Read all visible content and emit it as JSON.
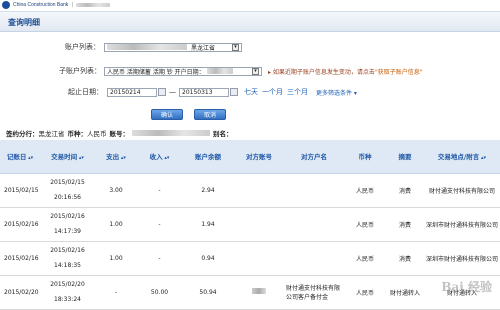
{
  "header": {
    "bank_name_en": "China Construction Bank",
    "page_title": "查询明细"
  },
  "form": {
    "account_list_label": "账户列表：",
    "account_list_value": "黑龙江省",
    "sub_account_label": "子账户列表：",
    "sub_account_value": "人民币 活期储蓄 活期 钞 开户日期：",
    "sub_account_hint": "如果近期子账户信息发生变动，请点击",
    "sub_account_hint_link": "\"获取子账户信息\"",
    "date_label": "起止日期：",
    "date_from": "20150214",
    "date_sep": "—",
    "date_to": "20150313",
    "quick_7d": "七天",
    "quick_1m": "一个月",
    "quick_3m": "三个月",
    "more_filters": "更多筛选条件 ▾",
    "confirm_label": "确认",
    "cancel_label": "取消"
  },
  "info": {
    "branch_label": "签约分行：",
    "branch_value": "黑龙江省",
    "currency_label": "币种：",
    "currency_value": "人民币",
    "account_label": "账号：",
    "alias_label": "别名："
  },
  "table": {
    "headers": [
      "记账日",
      "交易时间",
      "支出",
      "收入",
      "账户余额",
      "对方账号",
      "对方户名",
      "币种",
      "摘要",
      "交易地点/附言"
    ],
    "rows": [
      {
        "date": "2015/02/15",
        "time_date": "2015/02/15",
        "time_clock": "20:16:56",
        "out": "3.00",
        "in": "-",
        "balance": "2.94",
        "cp_account": "",
        "cp_name": "",
        "currency": "人民币",
        "summary": "消费",
        "place": "财付通支付科技有限公司"
      },
      {
        "date": "2015/02/16",
        "time_date": "2015/02/16",
        "time_clock": "14:17:39",
        "out": "1.00",
        "in": "-",
        "balance": "1.94",
        "cp_account": "",
        "cp_name": "",
        "currency": "人民币",
        "summary": "消费",
        "place": "深圳市财付通科技有限公司"
      },
      {
        "date": "2015/02/16",
        "time_date": "2015/02/16",
        "time_clock": "14:18:35",
        "out": "1.00",
        "in": "-",
        "balance": "0.94",
        "cp_account": "",
        "cp_name": "",
        "currency": "人民币",
        "summary": "消费",
        "place": "深圳市财付通科技有限公司"
      },
      {
        "date": "2015/02/20",
        "time_date": "2015/02/20",
        "time_clock": "18:33:24",
        "out": "-",
        "in": "50.00",
        "balance": "50.94",
        "cp_account": "",
        "cp_name": "财付通支付科技有限公司客户备付金",
        "currency": "人民币",
        "summary": "财付通转入",
        "place": "财付通转入"
      }
    ]
  },
  "watermark": "Bai 经验"
}
